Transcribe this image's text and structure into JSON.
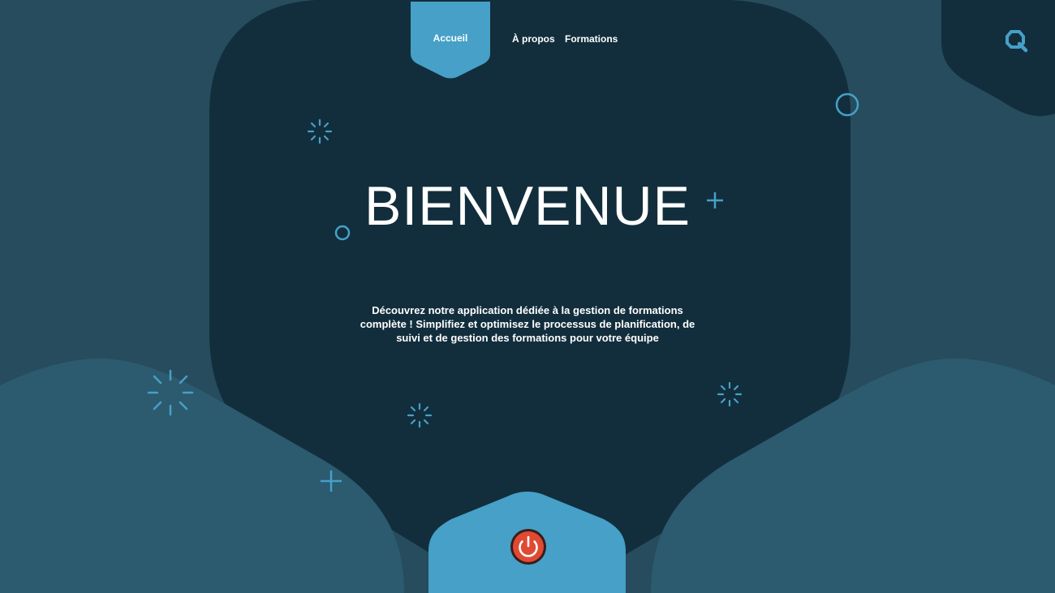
{
  "nav": {
    "items": [
      {
        "label": "Accueil",
        "active": true
      },
      {
        "label": "À propos",
        "active": false
      },
      {
        "label": "Formations",
        "active": false
      }
    ]
  },
  "hero": {
    "title": "BIENVENUE",
    "description": "Découvrez notre application dédiée à la gestion de formations complète ! Simplifiez et optimisez le processus de planification, de suivi et de gestion des formations pour votre équipe"
  },
  "icons": {
    "search": "search-icon",
    "power": "power-icon"
  },
  "colors": {
    "background": "#264c5d",
    "panel": "#122e3c",
    "wave": "#2c5a6f",
    "accent": "#46a0c8",
    "power": "#e04a33",
    "text": "#ffffff"
  }
}
